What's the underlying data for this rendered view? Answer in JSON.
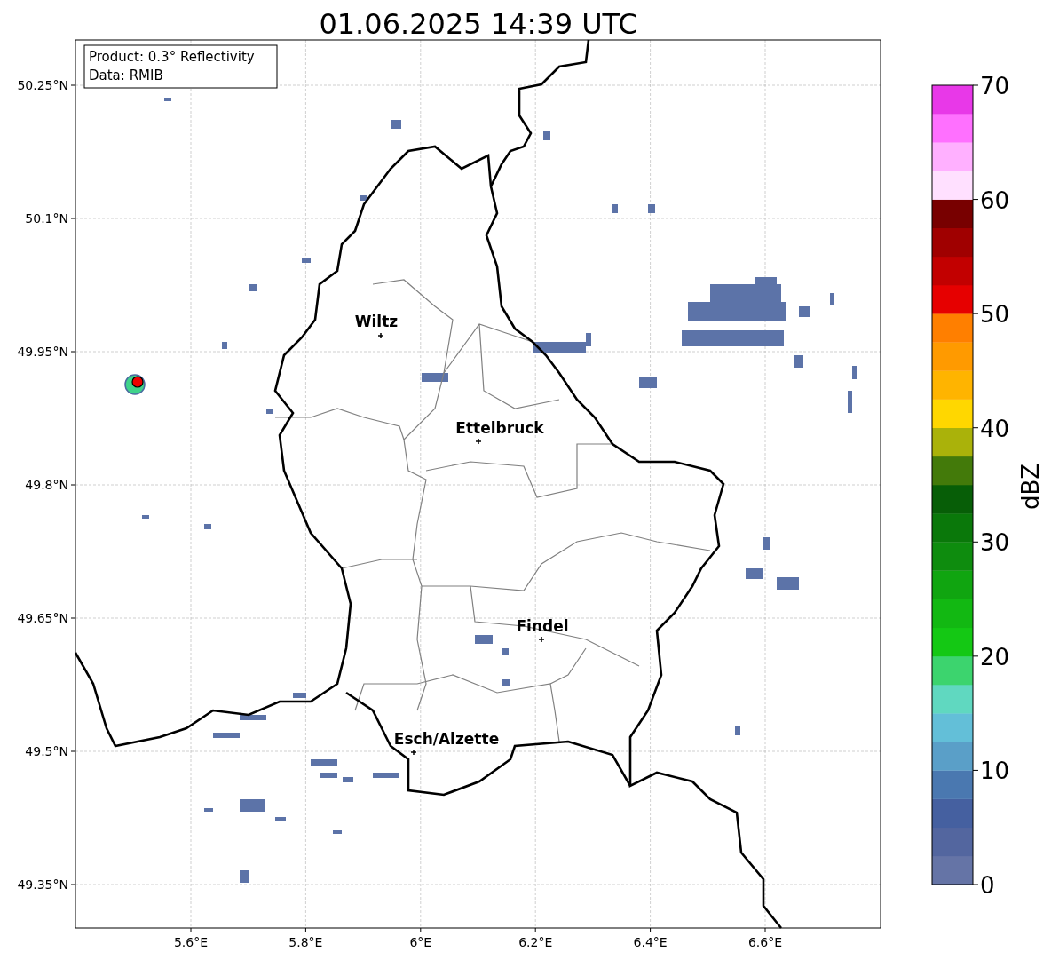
{
  "title": "01.06.2025 14:39 UTC",
  "info_box": {
    "lines": [
      "Product: 0.3° Reflectivity",
      "Data: RMIB"
    ]
  },
  "map": {
    "lat_ticks": [
      "50.25°N",
      "50.1°N",
      "49.95°N",
      "49.8°N",
      "49.65°N",
      "49.5°N",
      "49.35°N"
    ],
    "lon_ticks": [
      "5.6°E",
      "5.8°E",
      "6°E",
      "6.2°E",
      "6.4°E",
      "6.6°E"
    ],
    "cities": [
      {
        "name": "Wiltz"
      },
      {
        "name": "Ettelbruck"
      },
      {
        "name": "Findel"
      },
      {
        "name": "Esch/Alzette"
      }
    ]
  },
  "colorbar": {
    "label": "dBZ",
    "ticks": [
      "70",
      "60",
      "50",
      "40",
      "30",
      "20",
      "10",
      "0"
    ],
    "steps": [
      {
        "color": "#6574a6"
      },
      {
        "color": "#53669f"
      },
      {
        "color": "#4560a0"
      },
      {
        "color": "#4a78b0"
      },
      {
        "color": "#5a9fc8"
      },
      {
        "color": "#63bfd8"
      },
      {
        "color": "#60d8c0"
      },
      {
        "color": "#3cd46e"
      },
      {
        "color": "#14c814"
      },
      {
        "color": "#12b812"
      },
      {
        "color": "#10a510"
      },
      {
        "color": "#0e8c0e"
      },
      {
        "color": "#0a780a"
      },
      {
        "color": "#075e07"
      },
      {
        "color": "#437a0a"
      },
      {
        "color": "#aab20a"
      },
      {
        "color": "#ffd700"
      },
      {
        "color": "#ffb400"
      },
      {
        "color": "#ff9a00"
      },
      {
        "color": "#ff7f00"
      },
      {
        "color": "#e60000"
      },
      {
        "color": "#c20000"
      },
      {
        "color": "#a00000"
      },
      {
        "color": "#780000"
      },
      {
        "color": "#ffe0ff"
      },
      {
        "color": "#ffb0ff"
      },
      {
        "color": "#ff70ff"
      },
      {
        "color": "#e838e8"
      }
    ]
  }
}
